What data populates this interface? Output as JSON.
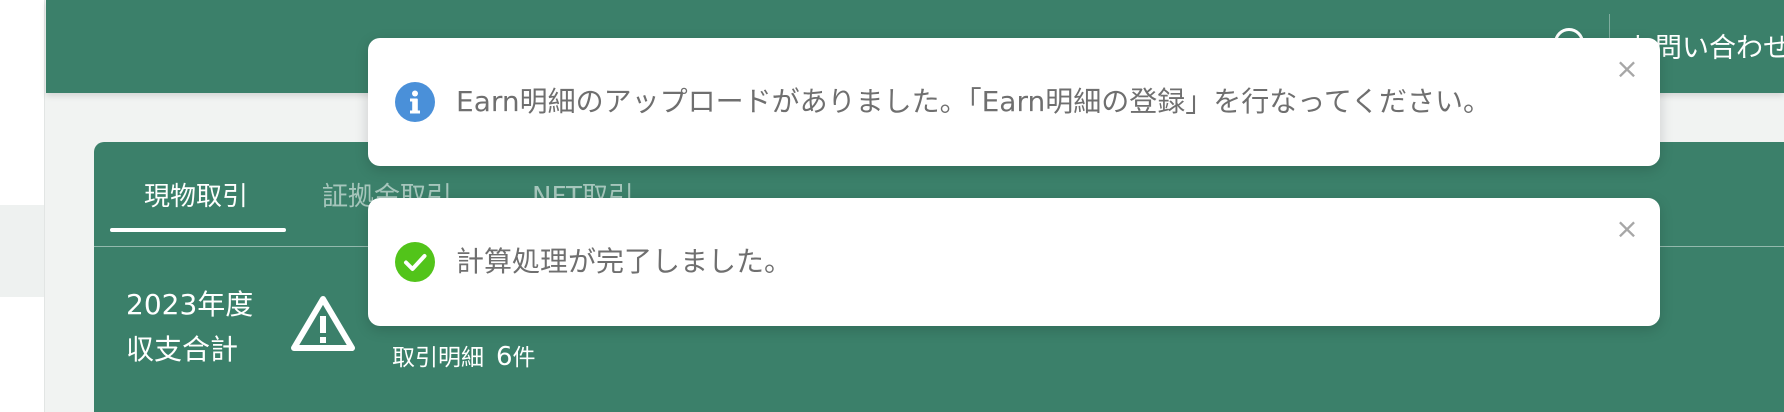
{
  "header": {
    "help_icon": "question-circle-icon",
    "contact_label": "お問い合わせ"
  },
  "tabs": [
    {
      "label": "現物取引",
      "active": true
    },
    {
      "label": "証拠金取引",
      "active": false
    },
    {
      "label": "NFT取引",
      "active": false
    }
  ],
  "summary": {
    "year_label": "2023年度",
    "total_label": "収支合計",
    "warning_icon": "warning-triangle-icon",
    "tx_label": "取引明細",
    "tx_count": "6",
    "tx_unit": "件"
  },
  "notifications": [
    {
      "type": "info",
      "icon": "info-circle-icon",
      "message": "Earn明細のアップロードがありました。「Earn明細の登録」を行なってください。",
      "close": "×"
    },
    {
      "type": "success",
      "icon": "check-circle-icon",
      "message": "計算処理が完了しました。",
      "close": "×"
    }
  ],
  "colors": {
    "brand_green": "#3b806a",
    "info_blue": "#4a90d9",
    "success_green": "#52c41a",
    "toast_text": "#6f6f6f"
  }
}
